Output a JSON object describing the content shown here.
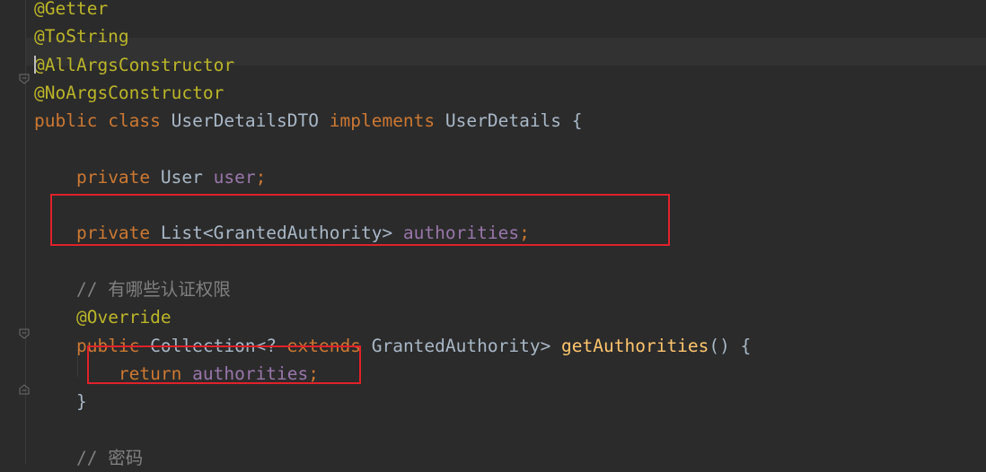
{
  "editor": {
    "lines": [
      {
        "tokens": [
          {
            "t": "@Getter",
            "c": "ann"
          }
        ]
      },
      {
        "tokens": [
          {
            "t": "@ToString",
            "c": "ann"
          }
        ]
      },
      {
        "tokens": [
          {
            "t": "@AllArgsConstructor",
            "c": "ann"
          }
        ]
      },
      {
        "tokens": [
          {
            "t": "@NoArgsConstructor",
            "c": "ann"
          }
        ]
      },
      {
        "tokens": [
          {
            "t": "public",
            "c": "kw"
          },
          {
            "t": " ",
            "c": "plain"
          },
          {
            "t": "class",
            "c": "kw"
          },
          {
            "t": " UserDetailsDTO ",
            "c": "cls"
          },
          {
            "t": "implements",
            "c": "kw"
          },
          {
            "t": " UserDetails {",
            "c": "cls"
          }
        ]
      },
      {
        "tokens": []
      },
      {
        "tokens": [
          {
            "t": "    ",
            "c": "plain"
          },
          {
            "t": "private",
            "c": "kw"
          },
          {
            "t": " User ",
            "c": "cls"
          },
          {
            "t": "user",
            "c": "fld"
          },
          {
            "t": ";",
            "c": "kw"
          }
        ]
      },
      {
        "tokens": []
      },
      {
        "tokens": [
          {
            "t": "    ",
            "c": "plain"
          },
          {
            "t": "private",
            "c": "kw"
          },
          {
            "t": " List<GrantedAuthority> ",
            "c": "cls"
          },
          {
            "t": "authorities",
            "c": "fld"
          },
          {
            "t": ";",
            "c": "kw"
          }
        ]
      },
      {
        "tokens": []
      },
      {
        "tokens": [
          {
            "t": "    ",
            "c": "plain"
          },
          {
            "t": "// 有哪些认证权限",
            "c": "cmt"
          }
        ]
      },
      {
        "tokens": [
          {
            "t": "    ",
            "c": "plain"
          },
          {
            "t": "@Override",
            "c": "ann"
          }
        ]
      },
      {
        "tokens": [
          {
            "t": "    ",
            "c": "plain"
          },
          {
            "t": "public",
            "c": "kw"
          },
          {
            "t": " Collection<? ",
            "c": "cls"
          },
          {
            "t": "extends",
            "c": "kw"
          },
          {
            "t": " GrantedAuthority> ",
            "c": "cls"
          },
          {
            "t": "getAuthorities",
            "c": "mth"
          },
          {
            "t": "() {",
            "c": "cls"
          }
        ]
      },
      {
        "tokens": [
          {
            "t": "        ",
            "c": "plain"
          },
          {
            "t": "return",
            "c": "kw"
          },
          {
            "t": " ",
            "c": "plain"
          },
          {
            "t": "authorities",
            "c": "fld"
          },
          {
            "t": ";",
            "c": "kw"
          }
        ]
      },
      {
        "tokens": [
          {
            "t": "    }",
            "c": "cls"
          }
        ]
      },
      {
        "tokens": []
      },
      {
        "tokens": [
          {
            "t": "    ",
            "c": "plain"
          },
          {
            "t": "// 密码",
            "c": "cmt"
          }
        ]
      }
    ],
    "colors": {
      "background": "#2b2b2b",
      "annotation": "#bbb529",
      "keyword": "#cc7832",
      "field": "#9876aa",
      "method": "#ffc66d",
      "comment": "#808080",
      "text": "#a9b7c6",
      "highlight_box": "#e0212a"
    }
  }
}
